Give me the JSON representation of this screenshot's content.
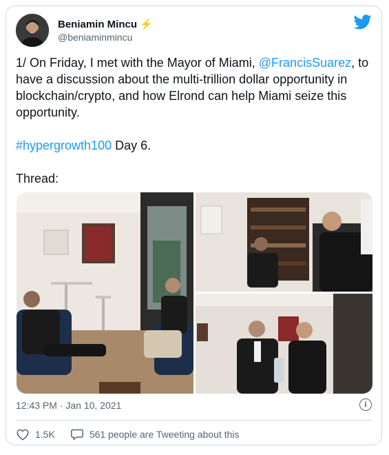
{
  "author": {
    "name": "Beniamin Mincu",
    "handle": "@beniaminmincu"
  },
  "tweet": {
    "line1_prefix": "1/ On Friday, I met with the Mayor of Miami, ",
    "mention": "@FrancisSuarez",
    "line1_suffix": ",",
    "body_rest": "to have a discussion about the multi-trillion dollar opportunity in blockchain/crypto, and how Elrond can help Miami seize this opportunity.",
    "hashtag": "#hypergrowth100",
    "hashtag_suffix": " Day 6.",
    "thread": "Thread:"
  },
  "meta": {
    "timestamp": "12:43 PM · Jan 10, 2021"
  },
  "stats": {
    "likes": "1.5K",
    "conversation": "561 people are Tweeting about this"
  },
  "colors": {
    "link": "#1d9bf0",
    "muted": "#536471",
    "border": "#cfd9de",
    "verified_bolt": "#f2b01e"
  },
  "icons": [
    "twitter-bird-icon",
    "lightning-icon",
    "info-icon",
    "heart-icon",
    "speech-bubble-icon"
  ]
}
